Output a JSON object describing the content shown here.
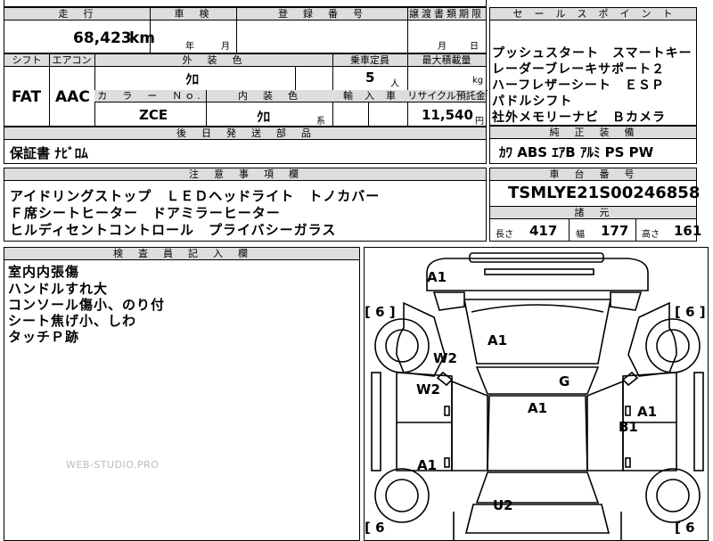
{
  "top": {
    "header_mileage": "走　行",
    "header_inspection": "車　検",
    "header_registration": "登　録　番　号",
    "header_transfer": "譲渡書類期限",
    "mileage_value": "68,423",
    "mileage_unit": "km",
    "inspection_year": "年",
    "inspection_month": "月",
    "transfer_month": "月",
    "transfer_day": "日"
  },
  "sales": {
    "header": "セ　ー　ル　ス　ポ　イ　ン　ト",
    "lines": [
      "プッシュスタート　スマートキー",
      "レーダーブレーキサポート２",
      "ハーフレザーシート　ＥＳＰ",
      "パドルシフト",
      "社外メモリーナビ　Ｂカメラ"
    ]
  },
  "specs": {
    "h_shift": "シフト",
    "h_aircon": "エアコン",
    "h_exterior": "外　装　色",
    "h_capacity": "乗車定員",
    "h_maxload": "最大積載量",
    "shift": "FAT",
    "aircon": "AAC",
    "exterior_color": "ｸﾛ",
    "capacity": "5",
    "capacity_unit": "人",
    "maxload_unit": "kg",
    "h_colorno": "カ　ラ　ー　Ｎｏ.",
    "h_interior": "内　装　色",
    "h_import": "輸　入　車",
    "h_recycle": "リサイクル預託金",
    "color_no": "ZCE",
    "interior_color": "ｸﾛ",
    "interior_suffix": "系",
    "recycle_fee": "11,540",
    "recycle_unit": "円"
  },
  "genuine": {
    "header": "純　正　装　備",
    "items": "ｶﾜ ABS ｴｱB ｱﾙﾐ PS PW"
  },
  "later_parts": {
    "header": "後　日　発　送　部　品",
    "items": "保証書 ﾅﾋﾞﾛﾑ"
  },
  "notes": {
    "header": "注　意　事　項　欄",
    "lines": [
      "アイドリングストップ　ＬＥＤヘッドライト　トノカバー",
      "Ｆ席シートヒーター　ドアミラーヒーター",
      "ヒルディセントコントロール　プライバシーガラス"
    ]
  },
  "chassis": {
    "header": "車　台　番　号",
    "number": "TSMLYE21S00246858",
    "dims_header": "諸　元",
    "length_label": "長さ",
    "length": "417",
    "width_label": "幅",
    "width": "177",
    "height_label": "高さ",
    "height": "161"
  },
  "inspector": {
    "header": "検　査　員　記　入　欄",
    "lines": [
      "室内内張傷",
      "ハンドルすれ大",
      "コンソール傷小、のり付",
      "シート焦げ小、しわ",
      "タッチＰ跡"
    ]
  },
  "diagram": {
    "tire_fl": "[ 6 ]",
    "tire_fr": "[ 6 ]",
    "tire_rl": "[ 6",
    "tire_rr": "[ 6",
    "marks": {
      "front_bumper": "A1",
      "hood": "A1",
      "windshield": "W2",
      "left_window": "W2",
      "right_fender_g": "G",
      "roof": "A1",
      "right_door": "A1",
      "right_door_b": "B1",
      "left_rear_door": "A1",
      "rear": "U2"
    }
  },
  "watermark": "WEB-STUDIO.PRO"
}
